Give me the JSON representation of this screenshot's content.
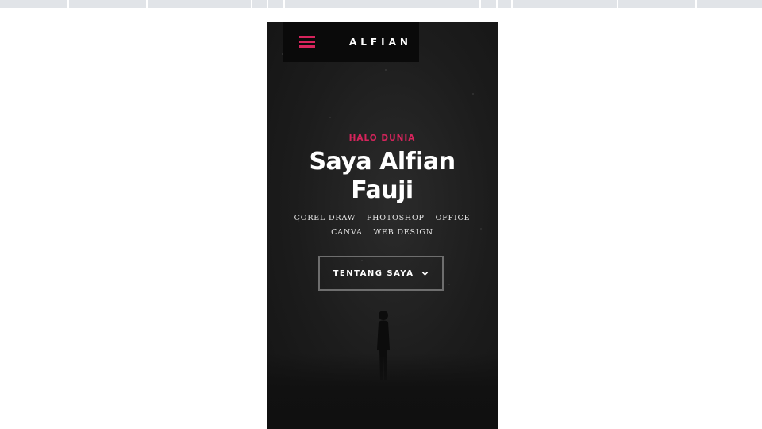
{
  "nav": {
    "brand": "ALFIAN",
    "menu_icon": "hamburger-menu-icon"
  },
  "hero": {
    "greeting": "HALO DUNIA",
    "title": "Saya Alfian Fauji",
    "skills": [
      "COREL DRAW",
      "PHOTOSHOP",
      "OFFICE",
      "CANVA",
      "WEB DESIGN"
    ],
    "cta_label": "TENTANG SAYA",
    "cta_icon": "chevron-down-icon"
  },
  "colors": {
    "accent": "#d6245c",
    "hero_bg": "#1c1c1c",
    "nav_bg": "#0a0a0a",
    "page_bg": "#ffffff",
    "toolbar": "#e1e4e8"
  }
}
